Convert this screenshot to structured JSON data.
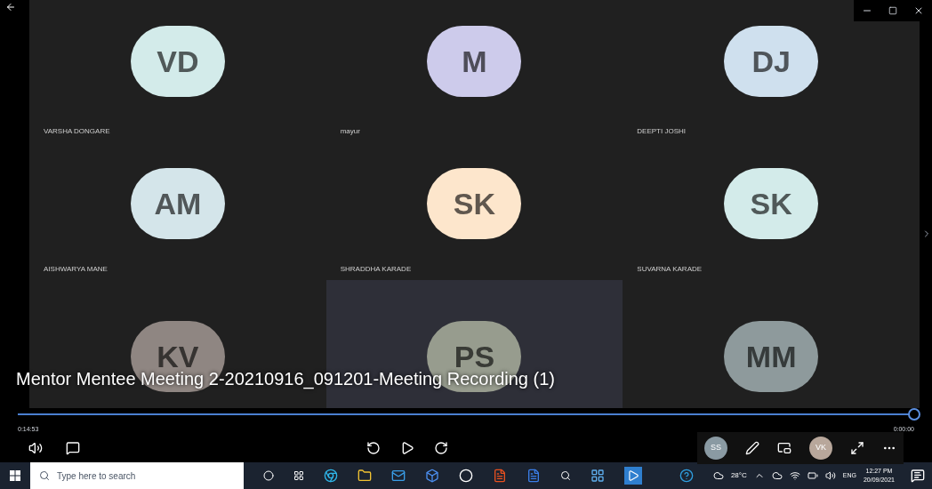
{
  "title": "Mentor Mentee Meeting 2-20210916_091201-Meeting Recording (1)",
  "participants": [
    {
      "initials": "VD",
      "name": "VARSHA DONGARE",
      "color": "#d3ebea",
      "highlighted": false
    },
    {
      "initials": "M",
      "name": "mayur",
      "color": "#cdcbeb",
      "highlighted": false
    },
    {
      "initials": "DJ",
      "name": "DEEPTI JOSHI",
      "color": "#cfe0ee",
      "highlighted": false
    },
    {
      "initials": "AM",
      "name": "AISHWARYA MANE",
      "color": "#d4e5ea",
      "highlighted": false
    },
    {
      "initials": "SK",
      "name": "SHRADDHA KARADE",
      "color": "#fde6cc",
      "highlighted": false
    },
    {
      "initials": "SK",
      "name": "SUVARNA KARADE",
      "color": "#d3ebea",
      "highlighted": false
    },
    {
      "initials": "KV",
      "color": "#8f8682",
      "highlighted": false
    },
    {
      "initials": "PS",
      "color": "#979c8e",
      "highlighted": true
    },
    {
      "initials": "MM",
      "color": "#8e9a9c",
      "highlighted": false
    }
  ],
  "player": {
    "elapsed": "0:14:53",
    "remaining": "0:00:00",
    "level": 1.0
  },
  "mini_participants": [
    {
      "initials": "SS",
      "color": "#8a9aa3"
    },
    {
      "initials": "VK",
      "color": "#b8a79b"
    }
  ],
  "taskbar": {
    "search_placeholder": "Type here to search",
    "weather": "28°C",
    "language": "ENG",
    "time": "12:27 PM",
    "date": "20/09/2021"
  }
}
